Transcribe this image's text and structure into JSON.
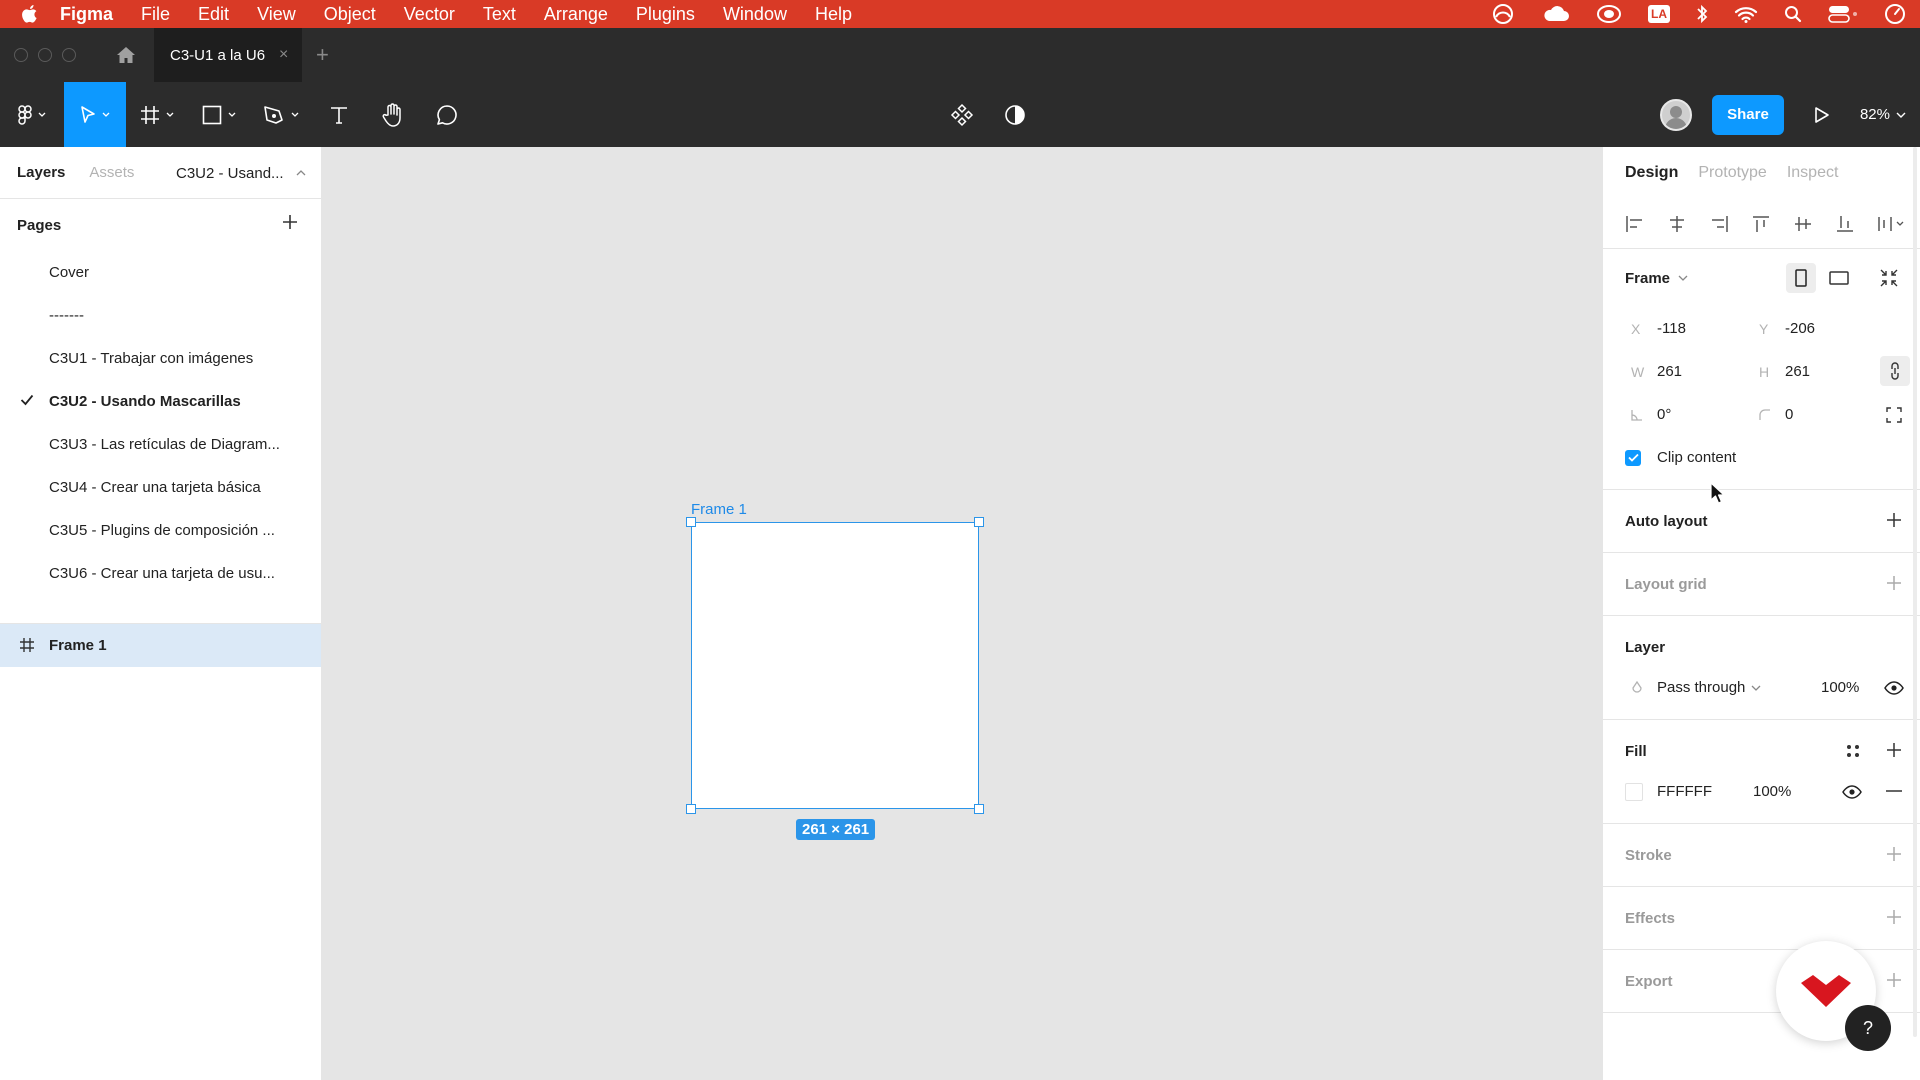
{
  "menubar": {
    "app_name": "Figma",
    "items": [
      "File",
      "Edit",
      "View",
      "Object",
      "Vector",
      "Text",
      "Arrange",
      "Plugins",
      "Window",
      "Help"
    ],
    "status_badge": "LA",
    "accent_color": "#d93a26"
  },
  "tabbar": {
    "file_tab": "C3-U1 a la U6",
    "close_glyph": "×",
    "add_glyph": "+"
  },
  "toolbar": {
    "share_label": "Share",
    "zoom": "82%"
  },
  "left_panel": {
    "tabs": [
      "Layers",
      "Assets"
    ],
    "active_tab": "Layers",
    "page_selector": "C3U2 - Usand...",
    "pages_title": "Pages",
    "pages": [
      "Cover",
      "-------",
      "C3U1 - Trabajar con imágenes",
      "C3U2 - Usando Mascarillas",
      "C3U3 - Las retículas de Diagram...",
      "C3U4 - Crear una tarjeta básica",
      "C3U5 - Plugins de composición ...",
      "C3U6 - Crear una tarjeta de usu..."
    ],
    "current_page_index": 3,
    "layers": [
      "Frame 1"
    ]
  },
  "canvas": {
    "frame_name": "Frame 1",
    "frame_size": "261 × 261",
    "selection_color": "#2b95e9"
  },
  "right_panel": {
    "tabs": [
      "Design",
      "Prototype",
      "Inspect"
    ],
    "active_tab": "Design",
    "frame": {
      "title": "Frame",
      "x_label": "X",
      "x": "-118",
      "y_label": "Y",
      "y": "-206",
      "w_label": "W",
      "w": "261",
      "h_label": "H",
      "h": "261",
      "rotation": "0°",
      "radius": "0",
      "clip_label": "Clip content",
      "clip_checked": true
    },
    "auto_layout": "Auto layout",
    "layout_grid": "Layout grid",
    "layer": {
      "title": "Layer",
      "blend": "Pass through",
      "opacity": "100%"
    },
    "fill": {
      "title": "Fill",
      "hex": "FFFFFF",
      "opacity": "100%"
    },
    "stroke": "Stroke",
    "effects": "Effects",
    "export": "Export"
  },
  "help": {
    "label": "?"
  }
}
